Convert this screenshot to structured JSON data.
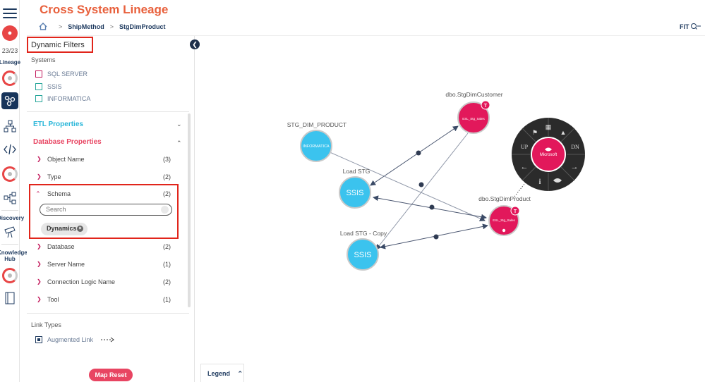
{
  "rail": {
    "count": "23/23",
    "lineage_label": "Lineage",
    "discovery_label": "Discovery",
    "knowledge_label": "Knowledge Hub"
  },
  "header": {
    "title": "Cross System Lineage",
    "breadcrumb": [
      "ShipMethod",
      "StgDimProduct"
    ],
    "fit_label": "FIT"
  },
  "filters": {
    "title": "Dynamic Filters",
    "systems_label": "Systems",
    "systems": [
      {
        "name": "SQL SERVER",
        "color": "#c2185b"
      },
      {
        "name": "SSIS",
        "color": "#26a69a"
      },
      {
        "name": "INFORMATICA",
        "color": "#26a69a"
      }
    ],
    "etl_label": "ETL Properties",
    "db_label": "Database Properties",
    "props": {
      "object_name": {
        "name": "Object Name",
        "count": "(3)"
      },
      "type": {
        "name": "Type",
        "count": "(2)"
      },
      "schema": {
        "name": "Schema",
        "count": "(2)"
      },
      "database": {
        "name": "Database",
        "count": "(2)"
      },
      "server_name": {
        "name": "Server Name",
        "count": "(1)"
      },
      "connection_logic": {
        "name": "Connection Logic Name",
        "count": "(2)"
      },
      "tool": {
        "name": "Tool",
        "count": "(1)"
      }
    },
    "search_placeholder": "Search",
    "chip": "Dynamics",
    "link_types_label": "Link Types",
    "augmented_link": "Augmented Link",
    "reset_button": "Map Reset"
  },
  "legend": "Legend",
  "graph": {
    "nodes": {
      "customer": {
        "label": "dbo.StgDimCustomer",
        "inner": "ESL_Stg_Sales",
        "badge": "T"
      },
      "informatica": {
        "label": "STG_DIM_PRODUCT",
        "inner": "INFORMATICA"
      },
      "load_stg": {
        "label": "Load STG",
        "inner": "SSIS"
      },
      "load_stg_copy": {
        "label": "Load STG - Copy",
        "inner": "SSIS"
      },
      "product": {
        "label": "dbo.StgDimProduct",
        "inner": "ESL_Stg_Sales",
        "badge": "T"
      }
    },
    "radial_menu": {
      "center": "Microsoft",
      "up": "UP",
      "dn": "DN"
    }
  },
  "colors": {
    "accent": "#e8603c",
    "ssis": "#3bc3ee",
    "sql": "#e2185b",
    "navy": "#1e3a5f"
  }
}
